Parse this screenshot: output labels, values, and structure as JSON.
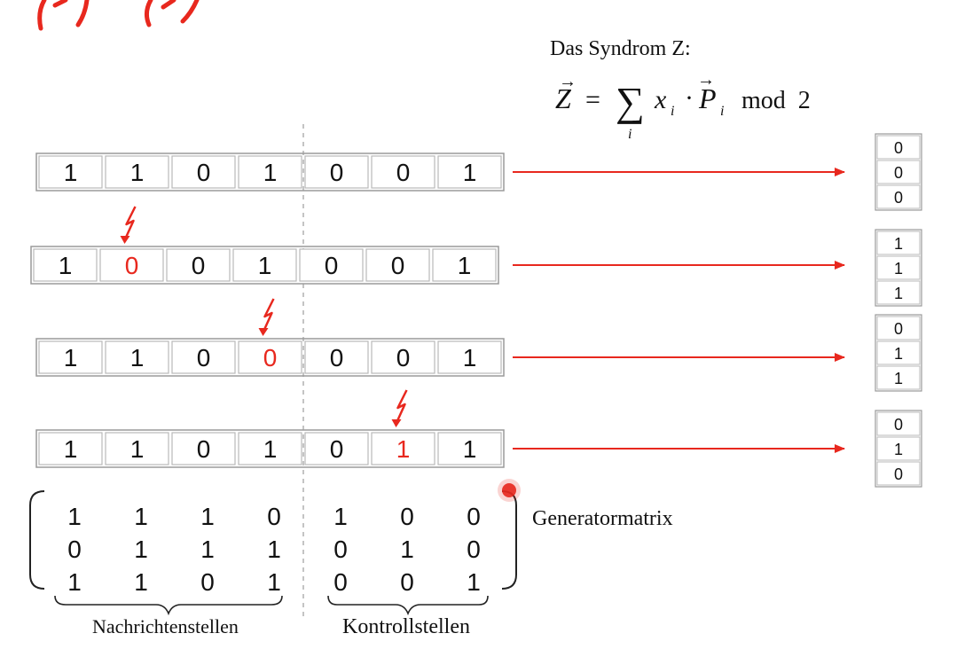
{
  "syndrome": {
    "title": "Das Syndrom Z:",
    "z_symbol": "Z",
    "equals": "=",
    "sum_symbol": "∑",
    "sum_index": "i",
    "x_symbol": "x",
    "x_sub": "i",
    "dot": "·",
    "p_symbol": "P",
    "p_sub": "i",
    "mod_text": "mod  2"
  },
  "codewords": [
    {
      "bits": [
        "1",
        "1",
        "0",
        "1",
        "0",
        "0",
        "1"
      ],
      "error_index": null,
      "syndrome": [
        "0",
        "0",
        "0"
      ]
    },
    {
      "bits": [
        "1",
        "0",
        "0",
        "1",
        "0",
        "0",
        "1"
      ],
      "error_index": 1,
      "syndrome": [
        "1",
        "1",
        "1"
      ]
    },
    {
      "bits": [
        "1",
        "1",
        "0",
        "0",
        "0",
        "0",
        "1"
      ],
      "error_index": 3,
      "syndrome": [
        "0",
        "1",
        "1"
      ]
    },
    {
      "bits": [
        "1",
        "1",
        "0",
        "1",
        "0",
        "1",
        "1"
      ],
      "error_index": 5,
      "syndrome": [
        "0",
        "1",
        "0"
      ]
    }
  ],
  "generator_matrix": {
    "rows": [
      [
        "1",
        "1",
        "1",
        "0",
        "1",
        "0",
        "0"
      ],
      [
        "0",
        "1",
        "1",
        "1",
        "0",
        "1",
        "0"
      ],
      [
        "1",
        "1",
        "0",
        "1",
        "0",
        "0",
        "1"
      ]
    ],
    "label": "Generatormatrix"
  },
  "labels": {
    "message_positions": "Nachrichtenstellen",
    "control_positions": "Kontrollstellen"
  },
  "colors": {
    "accent": "#e8281e",
    "cell_border": "#b9b9b9",
    "text": "#111111"
  }
}
